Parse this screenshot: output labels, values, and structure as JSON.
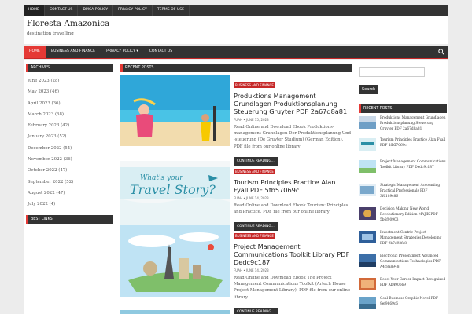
{
  "topbar": {
    "items": [
      "HOME",
      "CONTACT US",
      "DMCA POLICY",
      "PRIVACY POLICY",
      "TERMS OF USE"
    ]
  },
  "header": {
    "site_title": "Floresta Amazonica",
    "site_description": "destination travelling"
  },
  "nav": {
    "items": [
      "HOME",
      "BUSINESS AND FINANCE",
      "PRIVACY POLICY ▾",
      "CONTACT US"
    ],
    "search_icon": "search-icon"
  },
  "sidebar_left": {
    "archives_title": "ARCHIVES",
    "archives": [
      "June 2023 (28)",
      "May 2023 (46)",
      "April 2023 (36)",
      "March 2023 (68)",
      "February 2023 (42)",
      "January 2023 (52)",
      "December 2022 (54)",
      "November 2022 (36)",
      "October 2022 (47)",
      "September 2022 (52)",
      "August 2022 (47)",
      "July 2022 (4)"
    ],
    "best_links_title": "BEST LINKS"
  },
  "main": {
    "section_title": "RECENT POSTS",
    "posts": [
      {
        "category": "BUSINESS AND FINANCE",
        "title": "Produktions Management Grundlagen Produktionsplanung Steuerung Gruyter PDF 2a67d8a81",
        "author": "FUAH",
        "date": "JUNE 15, 2023",
        "excerpt": "Read Online and Download Ebook Produktions-management Grundlagen Der Produktionsplanung Und -steuerung (De Gruyter Studium) (German Edition). PDF file from our online library",
        "more": "CONTINUE READING..."
      },
      {
        "category": "BUSINESS AND FINANCE",
        "title": "Tourism Principles Practice Alan Fyall PDF 5fb57069c",
        "author": "FUAH",
        "date": "JUNE 14, 2023",
        "excerpt": "Read Online and Download Ebook Tourism: Principles and Practice. PDF file from our online library",
        "more": "CONTINUE READING..."
      },
      {
        "category": "BUSINESS AND FINANCE",
        "title": "Project Management Communications Toolkit Library PDF Dedc9c187",
        "author": "FUAH",
        "date": "JUNE 14, 2023",
        "excerpt": "Read Online and Download Ebook The Project Management Communications Toolkit (Artech House Project Management Library). PDF file from our online library",
        "more": "CONTINUE READING..."
      }
    ]
  },
  "sidebar_right": {
    "search_placeholder": "",
    "search_button": "Search",
    "recent_title": "RECENT POSTS",
    "recent": [
      "Produktions Management Grundlagen Produktionsplanung Steuerung Gruyter PDF 2a67d8a81",
      "Tourism Principles Practice Alan Fyall PDF 5fb57069c",
      "Project Management Communications Toolkit Library PDF Dedc9c187",
      "Strategic Management Accounting Practical Professionals PDF 3f6189c86",
      "Decision Making New World Revolutionary Edition MAJIK PDF 5b6f90903",
      "Investment Centric Project Management Strategies Developing PDF 9b7d93fe8",
      "Electronic Presentment Advanced Communications Technologies PDF A4c8a8948",
      "Boost Your Career Impact Recognized PDF Ab490b69",
      "Goal Business Graphic Novel PDF 9ef9669c6"
    ]
  },
  "colors": {
    "accent": "#e53935",
    "dark": "#333333"
  }
}
